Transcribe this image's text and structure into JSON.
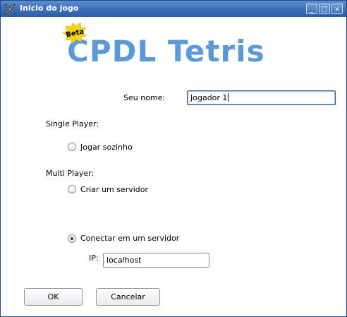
{
  "window": {
    "title": "Inicio do jogo",
    "minimize_glyph": "_",
    "maximize_glyph": "□",
    "close_glyph": "×"
  },
  "logo": {
    "badge": "Beta",
    "text": "CPDL Tetris",
    "color": "#5b9ad8",
    "badge_color": "#f3d21c"
  },
  "name_field": {
    "label": "Seu nome:",
    "value": "Jogador 1"
  },
  "single_player": {
    "section_label": "Single Player:",
    "options": [
      {
        "label": "Jogar sozinho",
        "selected": false
      }
    ]
  },
  "multi_player": {
    "section_label": "Multi Player:",
    "options": [
      {
        "label": "Criar um servidor",
        "selected": false
      },
      {
        "label": "Conectar em um servidor",
        "selected": true
      }
    ],
    "ip_label": "IP:",
    "ip_value": "localhost"
  },
  "buttons": {
    "ok": "OK",
    "cancel": "Cancelar"
  }
}
